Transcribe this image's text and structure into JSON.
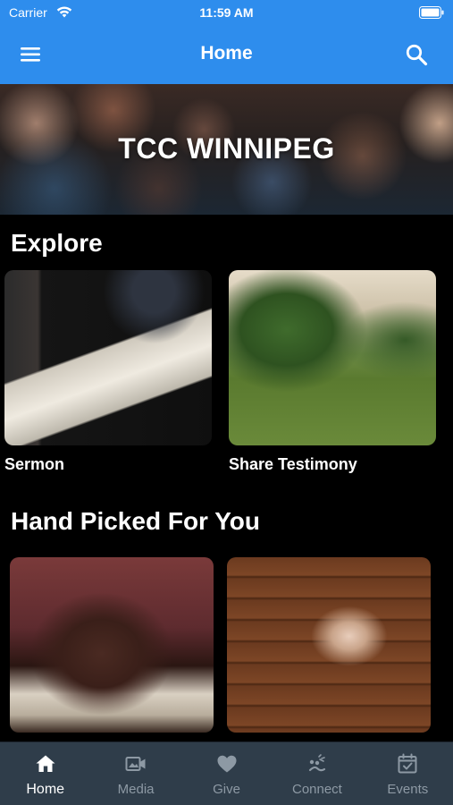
{
  "status_bar": {
    "carrier": "Carrier",
    "time": "11:59 AM",
    "icons": [
      "wifi-icon",
      "battery-icon"
    ]
  },
  "app_bar": {
    "title": "Home",
    "left_icon": "menu-icon",
    "right_icon": "search-icon",
    "background": "#2e8ded"
  },
  "hero": {
    "title": "TCC WINNIPEG"
  },
  "explore": {
    "title": "Explore",
    "cards": [
      {
        "label": "Sermon"
      },
      {
        "label": "Share Testimony"
      }
    ]
  },
  "hand_picked": {
    "title": "Hand Picked For You",
    "cards": [
      {
        "label": ""
      },
      {
        "label": ""
      }
    ]
  },
  "tab_bar": {
    "background": "#2f3d4a",
    "active_color": "#ffffff",
    "inactive_color": "#8d99a4",
    "tabs": [
      {
        "label": "Home",
        "icon": "home-icon",
        "active": true
      },
      {
        "label": "Media",
        "icon": "media-icon",
        "active": false
      },
      {
        "label": "Give",
        "icon": "heart-icon",
        "active": false
      },
      {
        "label": "Connect",
        "icon": "connect-icon",
        "active": false
      },
      {
        "label": "Events",
        "icon": "calendar-icon",
        "active": false
      }
    ]
  }
}
